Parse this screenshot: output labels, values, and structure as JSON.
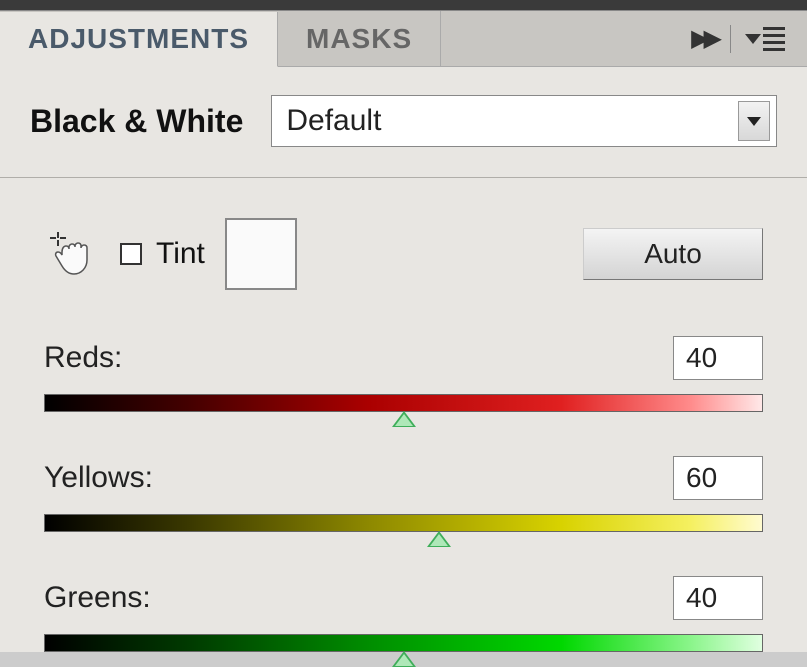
{
  "tabs": {
    "adjustments": "ADJUSTMENTS",
    "masks": "MASKS"
  },
  "header": {
    "title": "Black & White",
    "preset": "Default"
  },
  "controls": {
    "tint_label": "Tint",
    "auto_label": "Auto"
  },
  "sliders": [
    {
      "label": "Reds:",
      "value": "40",
      "track_class": "track-reds",
      "thumb_pos": "50%"
    },
    {
      "label": "Yellows:",
      "value": "60",
      "track_class": "track-yellows",
      "thumb_pos": "55%"
    },
    {
      "label": "Greens:",
      "value": "40",
      "track_class": "track-greens",
      "thumb_pos": "50%"
    }
  ]
}
